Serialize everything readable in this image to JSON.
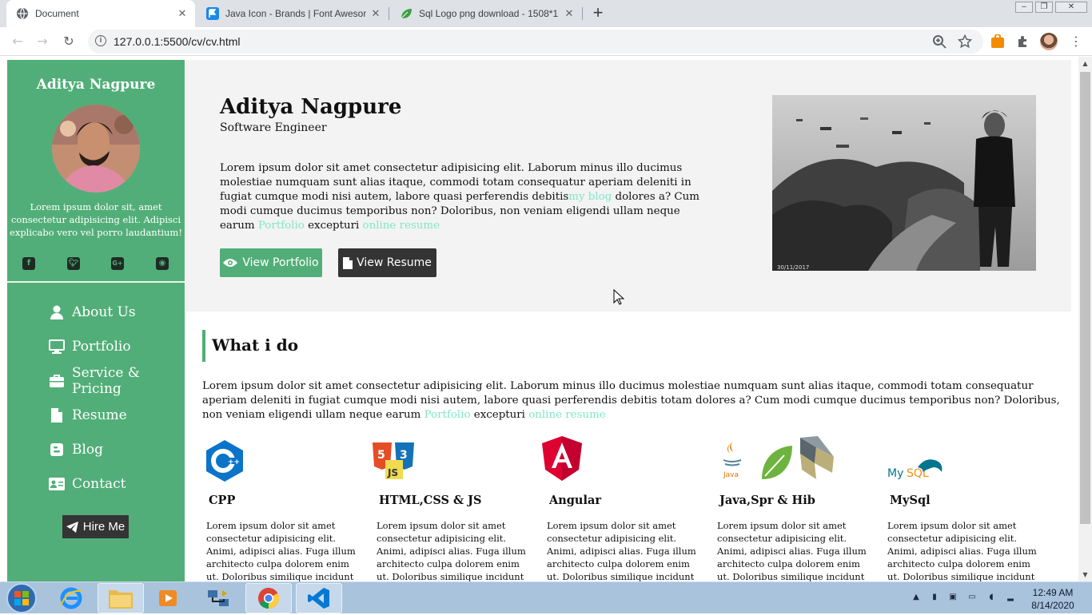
{
  "browser": {
    "tabs": [
      {
        "title": "Document",
        "active": true,
        "icon": "globe-icon"
      },
      {
        "title": "Java Icon - Brands | Font Awesome",
        "active": false,
        "icon": "font-awesome-flag-icon"
      },
      {
        "title": "Sql Logo png download - 1508*1",
        "active": false,
        "icon": "leaf-icon"
      }
    ],
    "close_glyph": "✕",
    "new_tab_glyph": "+",
    "url": "127.0.0.1:5500/cv/cv.html"
  },
  "sidebar": {
    "name": "Aditya Nagpure",
    "bio": "Lorem ipsum dolor sit, amet consectetur adipisicing elit. Adipisci explicabo vero vel porro laudantium!",
    "social": [
      "facebook-icon",
      "twitter-icon",
      "google-plus-icon",
      "github-icon"
    ],
    "nav": [
      {
        "label": "About Us",
        "icon": "user-icon"
      },
      {
        "label": "Portfolio",
        "icon": "desktop-icon"
      },
      {
        "label": "Service & Pricing",
        "icon": "briefcase-icon"
      },
      {
        "label": "Resume",
        "icon": "file-icon"
      },
      {
        "label": "Blog",
        "icon": "blogger-icon"
      },
      {
        "label": "Contact",
        "icon": "address-card-icon"
      }
    ],
    "hire_label": "Hire Me"
  },
  "hero": {
    "name": "Aditya Nagpure",
    "role": "Software Engineer",
    "text_1": "Lorem ipsum dolor sit amet consectetur adipisicing elit. Laborum minus illo ducimus molestiae numquam sunt alias itaque, commodi totam consequatur aperiam deleniti in fugiat cumque modi nisi autem, labore quasi perferendis debitis",
    "link_blog": "my blog",
    "text_2": " dolores a? Cum modi cumque ducimus temporibus non? Doloribus, non veniam eligendi ullam neque earum ",
    "link_portfolio": "Portfolio",
    "text_3": " excepturi ",
    "link_resume": "online resume",
    "btn_portfolio": "View Portfolio",
    "btn_resume": "View Resume",
    "photo_caption": "30/11/2017"
  },
  "what": {
    "title": "What i do",
    "text_1": "Lorem ipsum dolor sit amet consectetur adipisicing elit. Laborum minus illo ducimus molestiae numquam sunt alias itaque, commodi totam consequatur aperiam deleniti in fugiat cumque modi nisi autem, labore quasi perferendis debitis totam dolores a? Cum modi cumque ducimus temporibus non? Doloribus, non veniam eligendi ullam neque earum ",
    "link_portfolio": "Portfolio",
    "text_2": " excepturi ",
    "link_resume": "online resume",
    "skills": [
      {
        "title": "CPP",
        "logo": "cpp-logo",
        "text": "Lorem ipsum dolor sit amet consectetur adipisicing elit. Animi, adipisci alias. Fuga illum architecto culpa dolorem enim ut. Doloribus similique incidunt reiciendis"
      },
      {
        "title": "HTML,CSS & JS",
        "logo": "html-css-js-logo",
        "text": "Lorem ipsum dolor sit amet consectetur adipisicing elit. Animi, adipisci alias. Fuga illum architecto culpa dolorem enim ut. Doloribus similique incidunt reiciendis"
      },
      {
        "title": "Angular",
        "logo": "angular-logo",
        "text": "Lorem ipsum dolor sit amet consectetur adipisicing elit. Animi, adipisci alias. Fuga illum architecto culpa dolorem enim ut. Doloribus similique incidunt reiciendis"
      },
      {
        "title": "Java,Spr & Hib",
        "logo": "java-spring-hibernate-logo",
        "text": "Lorem ipsum dolor sit amet consectetur adipisicing elit. Animi, adipisci alias. Fuga illum architecto culpa dolorem enim ut. Doloribus similique incidunt reiciendis"
      },
      {
        "title": "MySql",
        "logo": "mysql-logo",
        "text": "Lorem ipsum dolor sit amet consectetur adipisicing elit. Animi, adipisci alias. Fuga illum architecto culpa dolorem enim ut. Doloribus similique incidunt reiciendis"
      }
    ]
  },
  "taskbar": {
    "time": "12:49 AM",
    "date": "8/14/2020",
    "apps": [
      "internet-explorer-icon",
      "file-explorer-icon",
      "media-player-icon",
      "network-icon",
      "chrome-icon",
      "vscode-icon"
    ]
  },
  "colors": {
    "sidebar_green": "#52ae78",
    "dark_button": "#343434",
    "link": "#7de8c8"
  }
}
